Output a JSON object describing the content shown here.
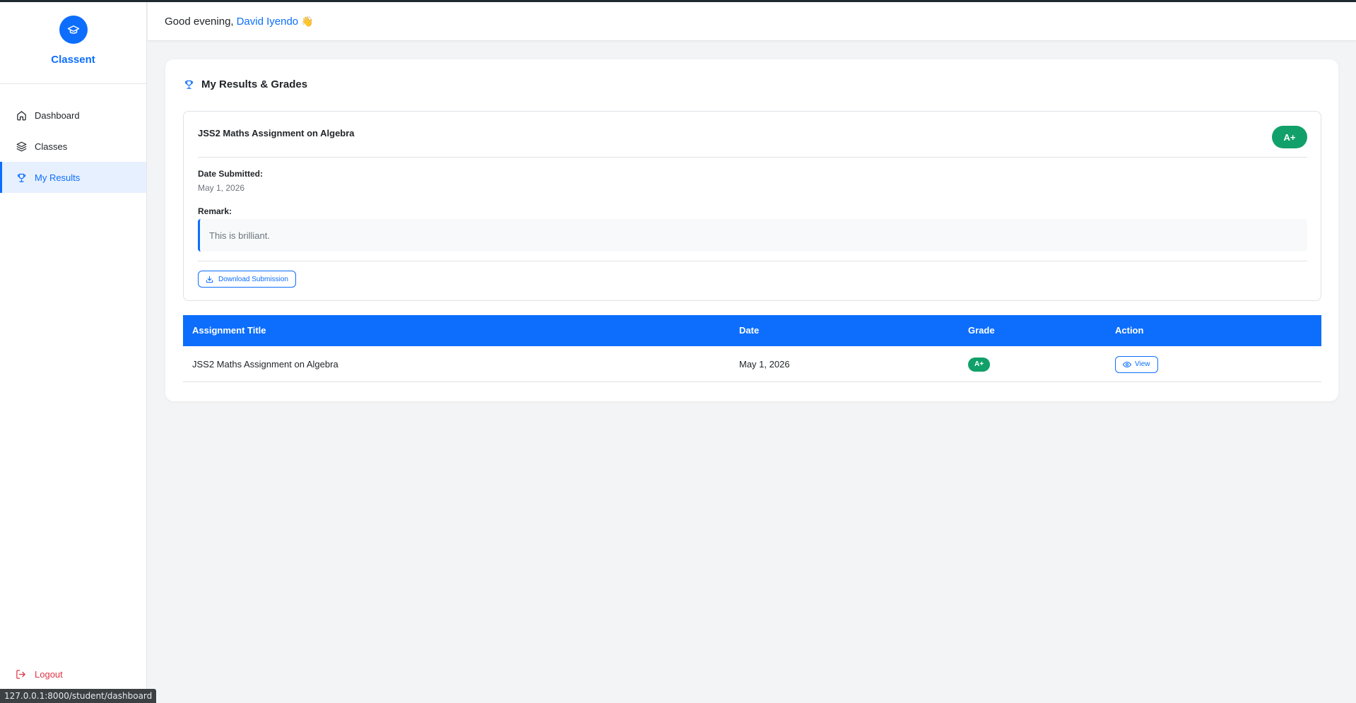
{
  "app": {
    "name": "Classent",
    "accent_color": "#0d6efd",
    "success_color": "#12a06a",
    "danger_color": "#dc3545"
  },
  "sidebar": {
    "items": [
      {
        "label": "Dashboard",
        "icon": "home-icon",
        "active": false
      },
      {
        "label": "Classes",
        "icon": "layers-icon",
        "active": false
      },
      {
        "label": "My Results",
        "icon": "trophy-icon",
        "active": true
      }
    ],
    "logout_label": "Logout"
  },
  "header": {
    "greeting": "Good evening,",
    "user_name": "David Iyendo",
    "emoji": "👋"
  },
  "results": {
    "title": "My Results & Grades",
    "detail": {
      "assignment_title": "JSS2 Maths Assignment on Algebra",
      "grade": "A+",
      "date_label": "Date Submitted:",
      "date_value": "May 1, 2026",
      "remark_label": "Remark:",
      "remark_value": "This is brilliant.",
      "download_label": "Download Submission"
    },
    "table": {
      "headers": [
        "Assignment Title",
        "Date",
        "Grade",
        "Action"
      ],
      "rows": [
        {
          "title": "JSS2 Maths Assignment on Algebra",
          "date": "May 1, 2026",
          "grade": "A+",
          "action": "View"
        }
      ]
    }
  },
  "status_bar": {
    "url": "127.0.0.1:8000/student/dashboard"
  }
}
